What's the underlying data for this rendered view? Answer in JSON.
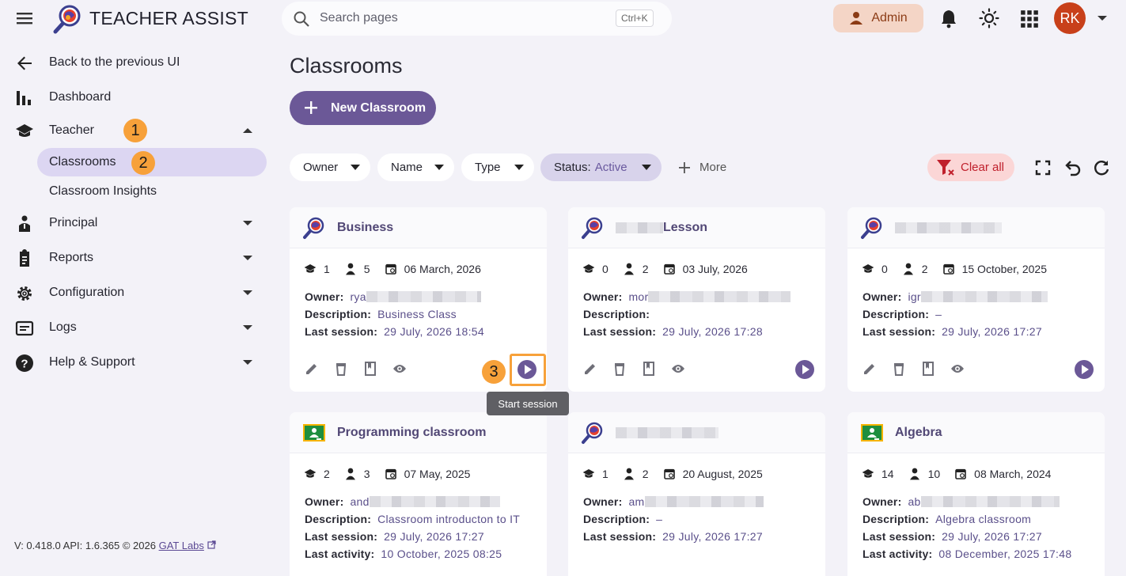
{
  "app": {
    "title": "TEACHER ASSIST"
  },
  "search": {
    "placeholder": "Search pages",
    "shortcut": "Ctrl+K"
  },
  "header": {
    "role_label": "Admin",
    "avatar_initials": "RK"
  },
  "nav": {
    "back": "Back to the previous UI",
    "dashboard": "Dashboard",
    "teacher": "Teacher",
    "classrooms": "Classrooms",
    "insights": "Classroom Insights",
    "principal": "Principal",
    "reports": "Reports",
    "configuration": "Configuration",
    "logs": "Logs",
    "help": "Help & Support"
  },
  "annotations": {
    "step1": "1",
    "step2": "2",
    "step3": "3"
  },
  "footer": {
    "version": "V: 0.418.0  API: 1.6.365  © 2026",
    "link": "GAT Labs"
  },
  "page": {
    "title": "Classrooms",
    "new_button": "New Classroom"
  },
  "filters": {
    "owner": "Owner",
    "name": "Name",
    "type": "Type",
    "status_label": "Status:",
    "status_value": "Active",
    "more": "More",
    "clear_all": "Clear all"
  },
  "tooltip": "Start session",
  "labels": {
    "owner": "Owner:",
    "description": "Description:",
    "last_session": "Last session:",
    "last_activity": "Last activity:"
  },
  "cards": [
    {
      "title": "Business",
      "teachers": "1",
      "students": "5",
      "date": "06 March, 2026",
      "owner_prefix": "rya",
      "description": "Business Class",
      "last_session": "29 July, 2026 18:54",
      "icon": "teacher-assist-logo"
    },
    {
      "title": "Lesson",
      "teachers": "0",
      "students": "2",
      "date": "03 July, 2026",
      "owner_prefix": "mor",
      "description": "",
      "last_session": "29 July, 2026 17:28",
      "icon": "teacher-assist-logo"
    },
    {
      "title": "",
      "teachers": "0",
      "students": "2",
      "date": "15 October, 2025",
      "owner_prefix": "igr",
      "description": "–",
      "last_session": "29 July, 2026 17:27",
      "icon": "teacher-assist-logo"
    },
    {
      "title": "Programming classroom",
      "teachers": "2",
      "students": "3",
      "date": "07 May, 2025",
      "owner_prefix": "and",
      "description": "Classroom introducton to IT",
      "last_session": "29 July, 2026 17:27",
      "last_activity": "10 October, 2025 08:25",
      "icon": "google-classroom-icon"
    },
    {
      "title": "",
      "teachers": "1",
      "students": "2",
      "date": "20 August, 2025",
      "owner_prefix": "am",
      "description": "–",
      "last_session": "29 July, 2026 17:27",
      "icon": "teacher-assist-logo"
    },
    {
      "title": "Algebra",
      "teachers": "14",
      "students": "10",
      "date": "08 March, 2024",
      "owner_prefix": "ab",
      "description": "Algebra classroom",
      "last_session": "29 July, 2026 17:27",
      "last_activity": "08 December, 2025 17:48",
      "icon": "google-classroom-icon"
    }
  ],
  "colors": {
    "accent": "#6b5897",
    "highlight": "#f7a13a",
    "danger": "#c0202c"
  }
}
